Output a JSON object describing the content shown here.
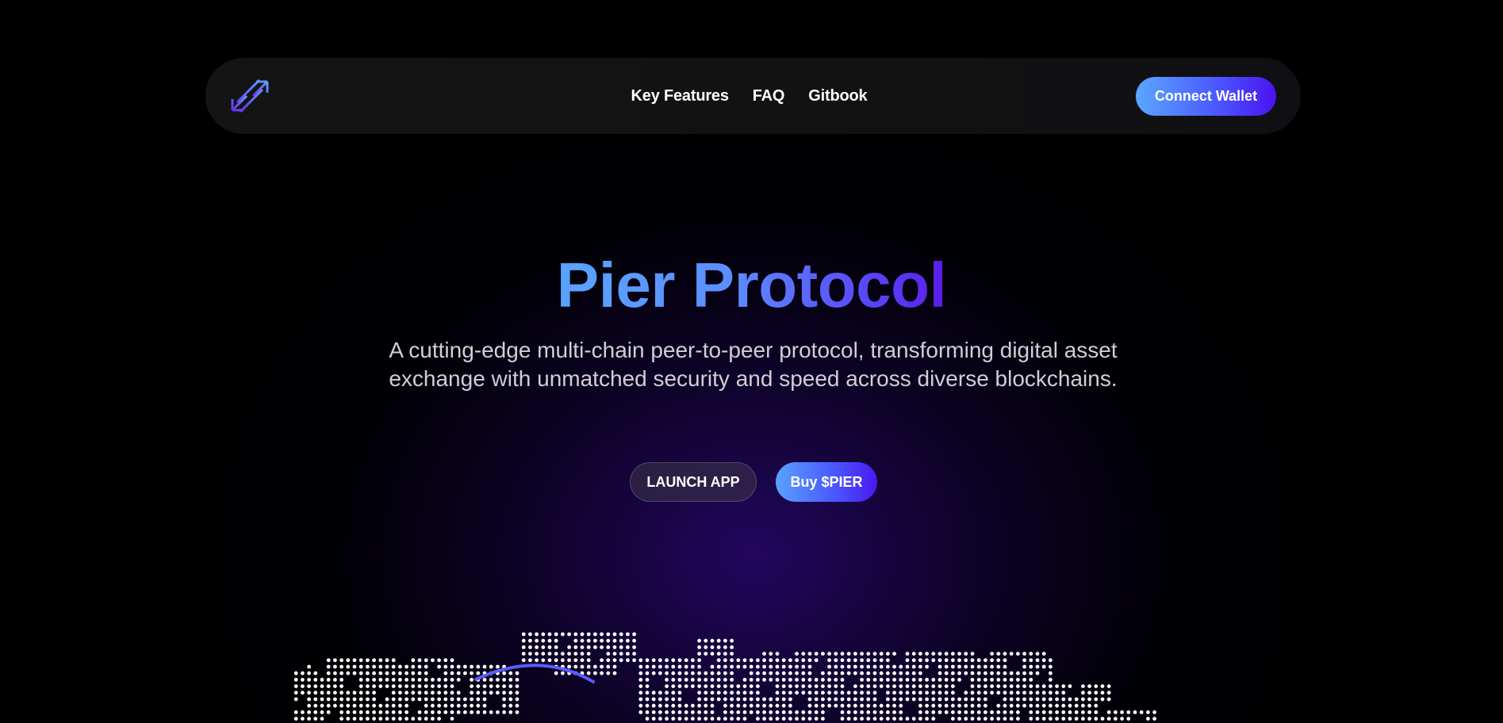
{
  "header": {
    "logo_icon": "double-arrow-icon",
    "nav": [
      {
        "label": "Key Features"
      },
      {
        "label": "FAQ"
      },
      {
        "label": "Gitbook"
      }
    ],
    "connect_label": "Connect Wallet"
  },
  "hero": {
    "title": "Pier Protocol",
    "subtitle": "A cutting-edge multi-chain peer-to-peer protocol, transforming digital asset exchange with unmatched security and speed across diverse blockchains.",
    "launch_label": "LAUNCH APP",
    "buy_label": "Buy $PIER"
  },
  "colors": {
    "accent_blue": "#58a4ff",
    "accent_purple": "#4a12f0",
    "background": "#000000",
    "nav_bg": "#121212"
  },
  "decor": {
    "map_icon": "dotted-world-map"
  }
}
